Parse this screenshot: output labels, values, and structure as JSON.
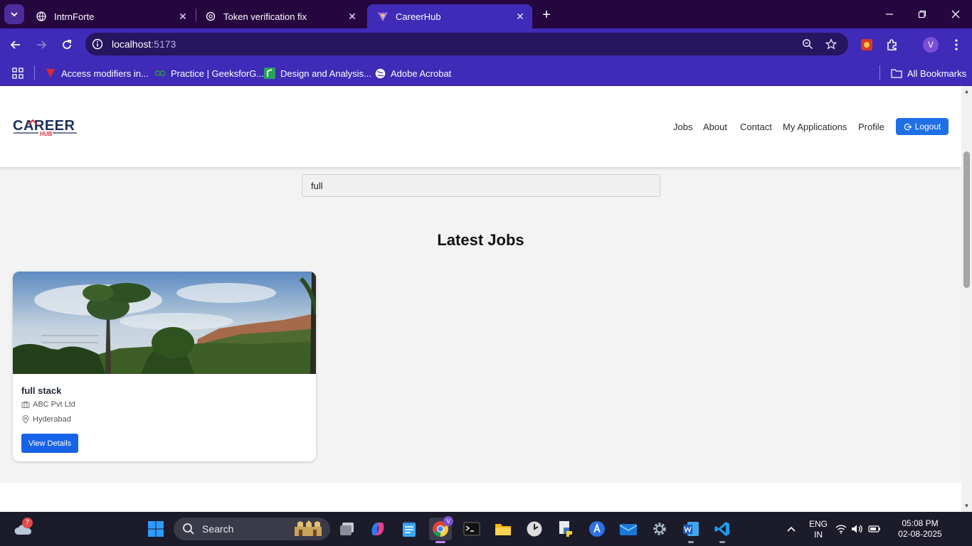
{
  "browser": {
    "tabs": [
      {
        "title": "IntrnForte",
        "active": false
      },
      {
        "title": "Token verification fix",
        "active": false
      },
      {
        "title": "CareerHub",
        "active": true
      }
    ],
    "url_host": "localhost",
    "url_port": ":5173",
    "profile_initial": "V",
    "bookmarks": [
      {
        "label": "Access modifiers in..."
      },
      {
        "label": "Practice | GeeksforG..."
      },
      {
        "label": "Design and Analysis..."
      },
      {
        "label": "Adobe Acrobat"
      }
    ],
    "all_bookmarks_label": "All Bookmarks",
    "colors": {
      "tabstrip": "#26063f",
      "toolbar": "#3f2bb8"
    }
  },
  "site": {
    "logo_text": "CAREER",
    "logo_sub": "HUB",
    "nav": [
      "Jobs",
      "About",
      "Contact",
      "My Applications",
      "Profile"
    ],
    "logout_label": "Logout",
    "search_value": "full",
    "section_title": "Latest Jobs",
    "jobs": [
      {
        "title": "full stack",
        "company": "ABC Pvt Ltd",
        "location": "Hyderabad",
        "button_label": "View Details"
      }
    ],
    "colors": {
      "primary": "#1f6fe5",
      "logo_navy": "#1b2f5e",
      "logo_red": "#d8312c"
    }
  },
  "taskbar": {
    "weather_badge": "7",
    "search_label": "Search",
    "language_line1": "ENG",
    "language_line2": "IN",
    "time": "05:08 PM",
    "date": "02-08-2025"
  }
}
